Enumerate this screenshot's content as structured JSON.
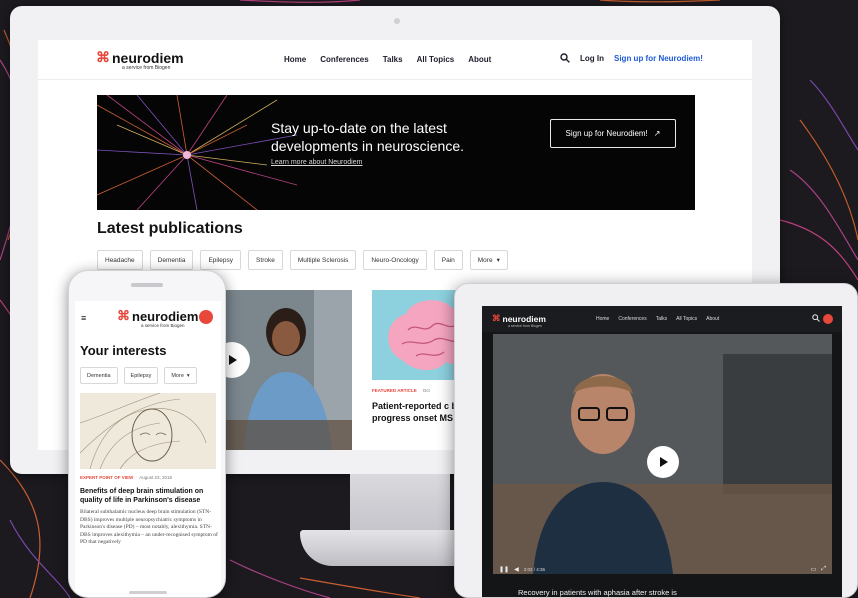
{
  "colors": {
    "brand_red": "#e8473b",
    "signup_blue": "#1f5bd6",
    "hero_bg": "#050505"
  },
  "brand": {
    "mark": "⌘",
    "name": "neurodiem",
    "tagline": "a service from Biogen"
  },
  "desktop": {
    "nav": [
      "Home",
      "Conferences",
      "Talks",
      "All Topics",
      "About"
    ],
    "search_icon": "search-icon",
    "login": "Log In",
    "signup": "Sign up for Neurodiem!",
    "hero": {
      "headline": "Stay up-to-date on the latest developments in neuroscience.",
      "learn_more": "Learn more about Neurodiem",
      "cta": "Sign up for Neurodiem!",
      "cta_icon": "↗"
    },
    "section_title": "Latest publications",
    "chips": [
      "Headache",
      "Dementia",
      "Epilepsy",
      "Stroke",
      "Multiple Sclerosis",
      "Neuro-Oncology",
      "Pain"
    ],
    "more_chip": "More",
    "card2": {
      "kicker": "FEATURED ARTICLE",
      "date": "Oct",
      "title": "Patient-reported c between progress onset MS more so"
    }
  },
  "phone": {
    "title": "Your interests",
    "chips": [
      "Dementia",
      "Epilepsy"
    ],
    "more_chip": "More",
    "kicker": "EXPERT POINT OF VIEW",
    "date": "August 23, 2018",
    "headline": "Benefits of deep brain stimulation on quality of life in Parkinson's disease",
    "body": "Bilateral subthalamic nucleus deep brain stimulation (STN-DBS) improves multiple neuropsychiatric symptoms in Parkinson's disease (PD) – most notably, alexithymia. STN-DBS improves alexithymia – an under-recognised symptom of PD that negatively"
  },
  "tablet": {
    "nav": [
      "Home",
      "Conferences",
      "Talks",
      "All Topics",
      "About"
    ],
    "time": "2:02 / 4:36",
    "caption": "Recovery in patients with aphasia after stroke is"
  }
}
